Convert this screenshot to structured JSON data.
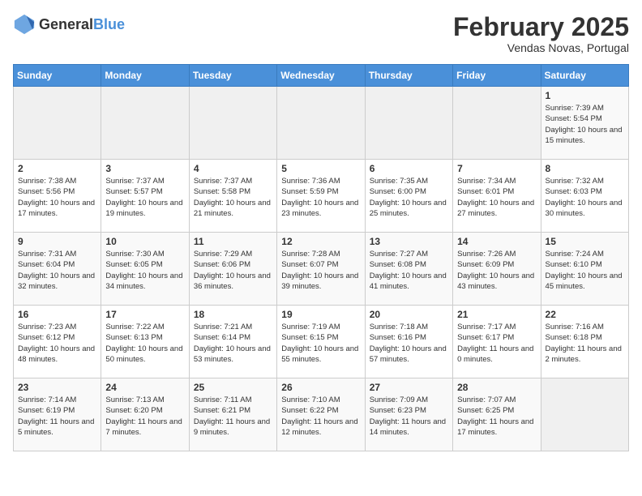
{
  "logo": {
    "general": "General",
    "blue": "Blue"
  },
  "header": {
    "title": "February 2025",
    "subtitle": "Vendas Novas, Portugal"
  },
  "weekdays": [
    "Sunday",
    "Monday",
    "Tuesday",
    "Wednesday",
    "Thursday",
    "Friday",
    "Saturday"
  ],
  "weeks": [
    [
      {
        "day": "",
        "info": ""
      },
      {
        "day": "",
        "info": ""
      },
      {
        "day": "",
        "info": ""
      },
      {
        "day": "",
        "info": ""
      },
      {
        "day": "",
        "info": ""
      },
      {
        "day": "",
        "info": ""
      },
      {
        "day": "1",
        "info": "Sunrise: 7:39 AM\nSunset: 5:54 PM\nDaylight: 10 hours\nand 15 minutes."
      }
    ],
    [
      {
        "day": "2",
        "info": "Sunrise: 7:38 AM\nSunset: 5:56 PM\nDaylight: 10 hours\nand 17 minutes."
      },
      {
        "day": "3",
        "info": "Sunrise: 7:37 AM\nSunset: 5:57 PM\nDaylight: 10 hours\nand 19 minutes."
      },
      {
        "day": "4",
        "info": "Sunrise: 7:37 AM\nSunset: 5:58 PM\nDaylight: 10 hours\nand 21 minutes."
      },
      {
        "day": "5",
        "info": "Sunrise: 7:36 AM\nSunset: 5:59 PM\nDaylight: 10 hours\nand 23 minutes."
      },
      {
        "day": "6",
        "info": "Sunrise: 7:35 AM\nSunset: 6:00 PM\nDaylight: 10 hours\nand 25 minutes."
      },
      {
        "day": "7",
        "info": "Sunrise: 7:34 AM\nSunset: 6:01 PM\nDaylight: 10 hours\nand 27 minutes."
      },
      {
        "day": "8",
        "info": "Sunrise: 7:32 AM\nSunset: 6:03 PM\nDaylight: 10 hours\nand 30 minutes."
      }
    ],
    [
      {
        "day": "9",
        "info": "Sunrise: 7:31 AM\nSunset: 6:04 PM\nDaylight: 10 hours\nand 32 minutes."
      },
      {
        "day": "10",
        "info": "Sunrise: 7:30 AM\nSunset: 6:05 PM\nDaylight: 10 hours\nand 34 minutes."
      },
      {
        "day": "11",
        "info": "Sunrise: 7:29 AM\nSunset: 6:06 PM\nDaylight: 10 hours\nand 36 minutes."
      },
      {
        "day": "12",
        "info": "Sunrise: 7:28 AM\nSunset: 6:07 PM\nDaylight: 10 hours\nand 39 minutes."
      },
      {
        "day": "13",
        "info": "Sunrise: 7:27 AM\nSunset: 6:08 PM\nDaylight: 10 hours\nand 41 minutes."
      },
      {
        "day": "14",
        "info": "Sunrise: 7:26 AM\nSunset: 6:09 PM\nDaylight: 10 hours\nand 43 minutes."
      },
      {
        "day": "15",
        "info": "Sunrise: 7:24 AM\nSunset: 6:10 PM\nDaylight: 10 hours\nand 45 minutes."
      }
    ],
    [
      {
        "day": "16",
        "info": "Sunrise: 7:23 AM\nSunset: 6:12 PM\nDaylight: 10 hours\nand 48 minutes."
      },
      {
        "day": "17",
        "info": "Sunrise: 7:22 AM\nSunset: 6:13 PM\nDaylight: 10 hours\nand 50 minutes."
      },
      {
        "day": "18",
        "info": "Sunrise: 7:21 AM\nSunset: 6:14 PM\nDaylight: 10 hours\nand 53 minutes."
      },
      {
        "day": "19",
        "info": "Sunrise: 7:19 AM\nSunset: 6:15 PM\nDaylight: 10 hours\nand 55 minutes."
      },
      {
        "day": "20",
        "info": "Sunrise: 7:18 AM\nSunset: 6:16 PM\nDaylight: 10 hours\nand 57 minutes."
      },
      {
        "day": "21",
        "info": "Sunrise: 7:17 AM\nSunset: 6:17 PM\nDaylight: 11 hours\nand 0 minutes."
      },
      {
        "day": "22",
        "info": "Sunrise: 7:16 AM\nSunset: 6:18 PM\nDaylight: 11 hours\nand 2 minutes."
      }
    ],
    [
      {
        "day": "23",
        "info": "Sunrise: 7:14 AM\nSunset: 6:19 PM\nDaylight: 11 hours\nand 5 minutes."
      },
      {
        "day": "24",
        "info": "Sunrise: 7:13 AM\nSunset: 6:20 PM\nDaylight: 11 hours\nand 7 minutes."
      },
      {
        "day": "25",
        "info": "Sunrise: 7:11 AM\nSunset: 6:21 PM\nDaylight: 11 hours\nand 9 minutes."
      },
      {
        "day": "26",
        "info": "Sunrise: 7:10 AM\nSunset: 6:22 PM\nDaylight: 11 hours\nand 12 minutes."
      },
      {
        "day": "27",
        "info": "Sunrise: 7:09 AM\nSunset: 6:23 PM\nDaylight: 11 hours\nand 14 minutes."
      },
      {
        "day": "28",
        "info": "Sunrise: 7:07 AM\nSunset: 6:25 PM\nDaylight: 11 hours\nand 17 minutes."
      },
      {
        "day": "",
        "info": ""
      }
    ]
  ]
}
